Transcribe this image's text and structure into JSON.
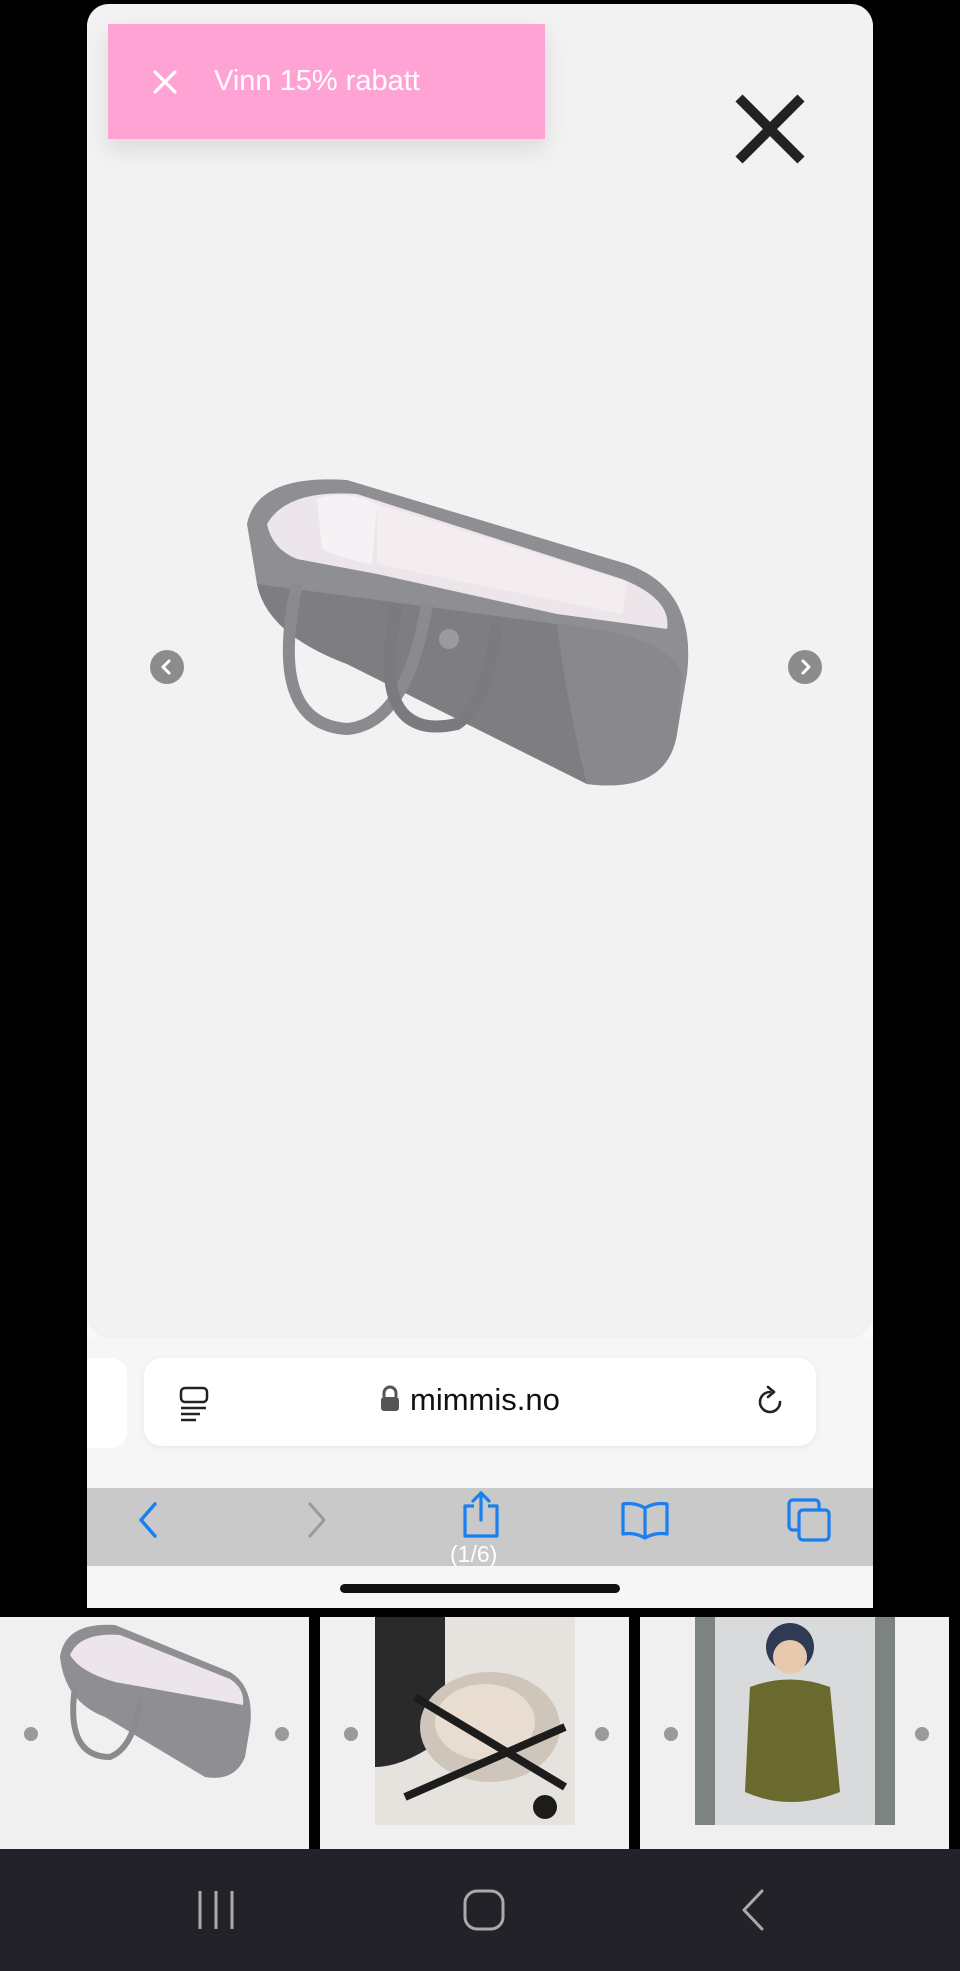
{
  "promo": {
    "label": "Vinn 15% rabatt"
  },
  "gallery": {
    "counter": "(1/6)"
  },
  "browser": {
    "domain": "mimmis.no"
  },
  "icons": {
    "promo_close": "close-icon",
    "viewer_close": "close-icon",
    "prev": "chevron-left-icon",
    "next": "chevron-right-icon",
    "reader": "reader-mode-icon",
    "lock": "lock-icon",
    "reload": "reload-icon",
    "back": "back-icon",
    "forward": "forward-icon",
    "share": "share-icon",
    "bookmarks": "bookmarks-icon",
    "tabs": "tabs-icon"
  },
  "colors": {
    "promo_bg": "#ffa3d5",
    "accent": "#1a7ff0",
    "viewer_bg": "#f2f2f2"
  }
}
